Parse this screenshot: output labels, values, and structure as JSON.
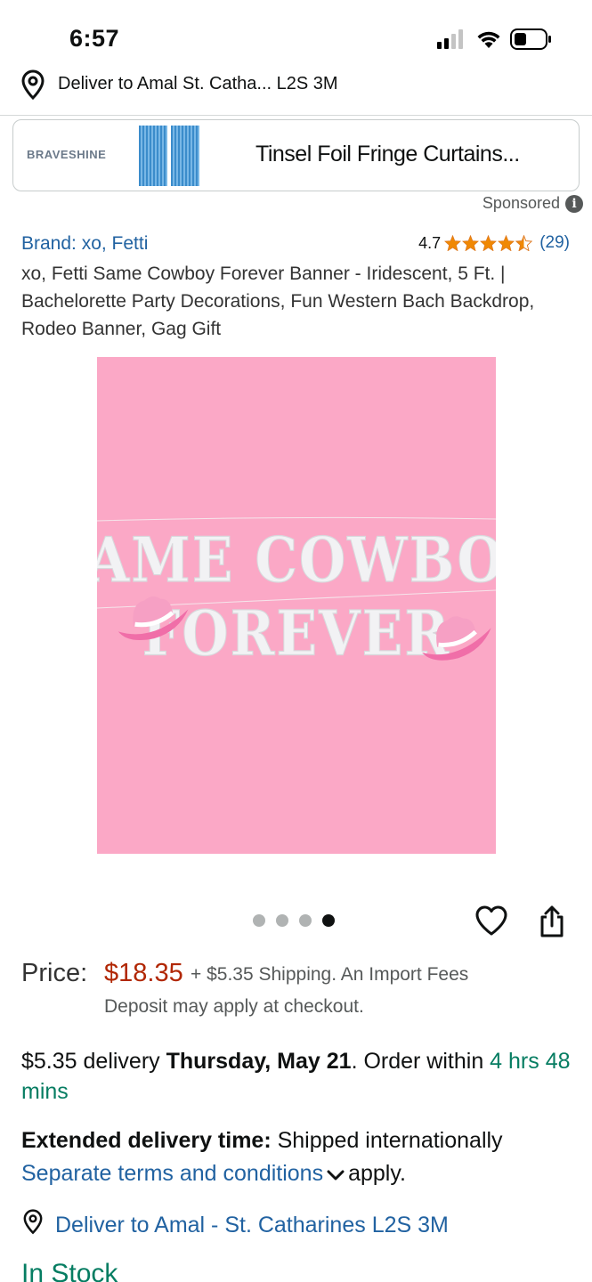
{
  "status": {
    "time": "6:57"
  },
  "deliver": {
    "text": "Deliver to Amal St. Catha... L2S 3M"
  },
  "ad": {
    "brand": "BRAVESHINE",
    "title": "Tinsel Foil Fringe Curtains...",
    "sponsored": "Sponsored"
  },
  "product": {
    "brand": "Brand: xo, Fetti",
    "rating": "4.7",
    "rating_value": 4.7,
    "review_count": "(29)",
    "title": "xo, Fetti Same Cowboy Forever Banner - Iridescent, 5 Ft. | Bachelorette Party Decorations, Fun Western Bach Backdrop, Rodeo Banner, Gag Gift",
    "image": {
      "line1": "SAME COWBOY",
      "line2": "FOREVER"
    },
    "dots": {
      "count": 4,
      "active_index": 3
    }
  },
  "price": {
    "label": "Price:",
    "value": "$18.35",
    "shipping": "+ $5.35 Shipping. An Import Fees",
    "note": "Deposit may apply at checkout."
  },
  "delivery": {
    "prefix": "$5.35 delivery ",
    "date": "Thursday, May 21",
    "middle": ". Order within ",
    "countdown": "4 hrs 48 mins"
  },
  "extended": {
    "label": "Extended delivery time:",
    "text": " Shipped internationally",
    "link": "Separate terms and conditions",
    "suffix": "apply."
  },
  "deliver_to": {
    "text": "Deliver to Amal - St. Catharines L2S 3M"
  },
  "stock": {
    "text": "In Stock"
  },
  "colors": {
    "link": "#2162a1",
    "price": "#b12704",
    "green": "#067d62",
    "star": "#f08804",
    "image_bg": "#fba8c6"
  }
}
